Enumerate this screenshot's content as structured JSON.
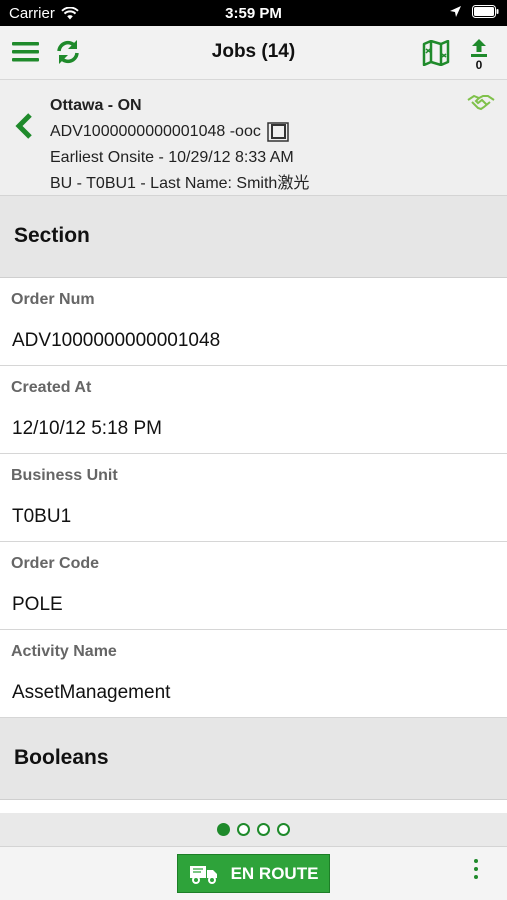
{
  "status_bar": {
    "carrier": "Carrier",
    "time": "3:59 PM"
  },
  "nav": {
    "title": "Jobs (14)",
    "upload_count": "0",
    "accent_color": "#1f8a2b"
  },
  "job": {
    "city": "Ottawa - ON",
    "order_line": "ADV1000000000001048 -ooc",
    "earliest_onsite": "Earliest Onsite - 10/29/12 8:33 AM",
    "bu_line": "BU - T0BU1 - Last Name: Smith激光"
  },
  "sections": [
    {
      "title": "Section"
    },
    {
      "title": "Booleans"
    }
  ],
  "fields": [
    {
      "label": "Order Num",
      "value": "ADV1000000000001048"
    },
    {
      "label": "Created At",
      "value": "12/10/12 5:18 PM"
    },
    {
      "label": "Business Unit",
      "value": "T0BU1"
    },
    {
      "label": "Order Code",
      "value": "POLE"
    },
    {
      "label": "Activity Name",
      "value": "AssetManagement"
    }
  ],
  "pager": {
    "pages": 4,
    "current": 1
  },
  "toolbar": {
    "action_label": "EN ROUTE",
    "action_icon": "truck-icon",
    "more_icon": "more-vertical-icon"
  }
}
